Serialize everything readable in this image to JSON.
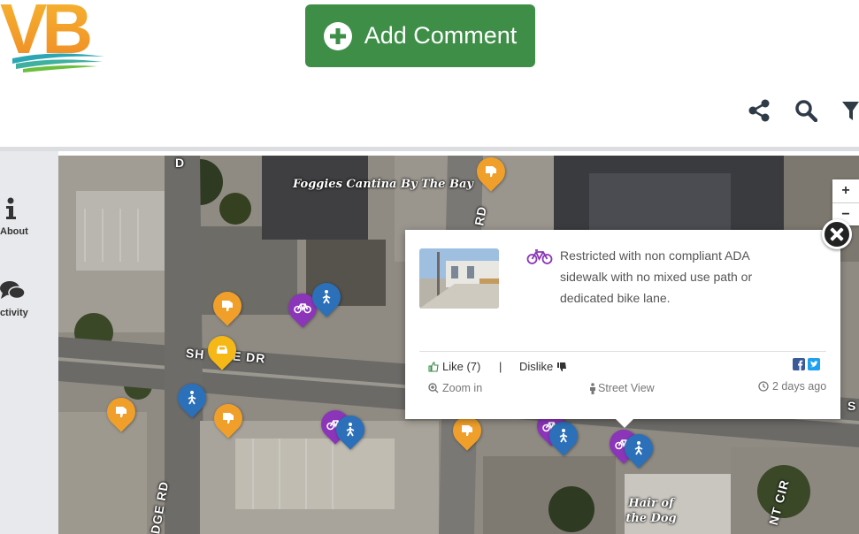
{
  "header": {
    "logo_text": "VB",
    "add_comment_label": "Add Comment",
    "tools": [
      "share-icon",
      "search-icon",
      "filter-icon"
    ]
  },
  "sidebar": {
    "items": [
      {
        "label": "About",
        "icon": "info-icon"
      },
      {
        "label": "Activity",
        "icon": "comments-icon"
      }
    ]
  },
  "map": {
    "zoom_in_label": "+",
    "zoom_out_label": "−",
    "places": [
      {
        "name": "Foggies Cantina By The Bay"
      },
      {
        "name": "Hair of the Dog"
      }
    ],
    "streets": {
      "shore_dr_left": "SH",
      "shore_dr_right": "E DR",
      "road_rd": "RD",
      "ridge_rd": "DGE RD",
      "cir": "NT CIR",
      "s_right": "S",
      "d_top": "D"
    },
    "markers": [
      {
        "category": "dislike",
        "color": "#f0a02a"
      },
      {
        "category": "bike",
        "color": "#8b35b8"
      },
      {
        "category": "pedestrian",
        "color": "#2b70b8"
      },
      {
        "category": "car",
        "color": "#f5b816"
      }
    ]
  },
  "popup": {
    "category_icon": "bicycle-icon",
    "description": "Restricted with non compliant ADA sidewalk with no mixed use path or dedicated bike lane.",
    "like_label": "Like (7)",
    "separator": "|",
    "dislike_label": "Dislike",
    "zoom_in_label": "Zoom in",
    "street_view_label": "Street View",
    "timestamp": "2 days ago",
    "share": [
      "facebook-icon",
      "twitter-icon"
    ]
  },
  "colors": {
    "accent_green": "#3e8e48",
    "marker_orange": "#f0a02a",
    "marker_blue": "#2b70b8",
    "marker_purple": "#8b35b8",
    "logo_orange": "#f39a2a",
    "logo_teal": "#2aa6b5"
  }
}
